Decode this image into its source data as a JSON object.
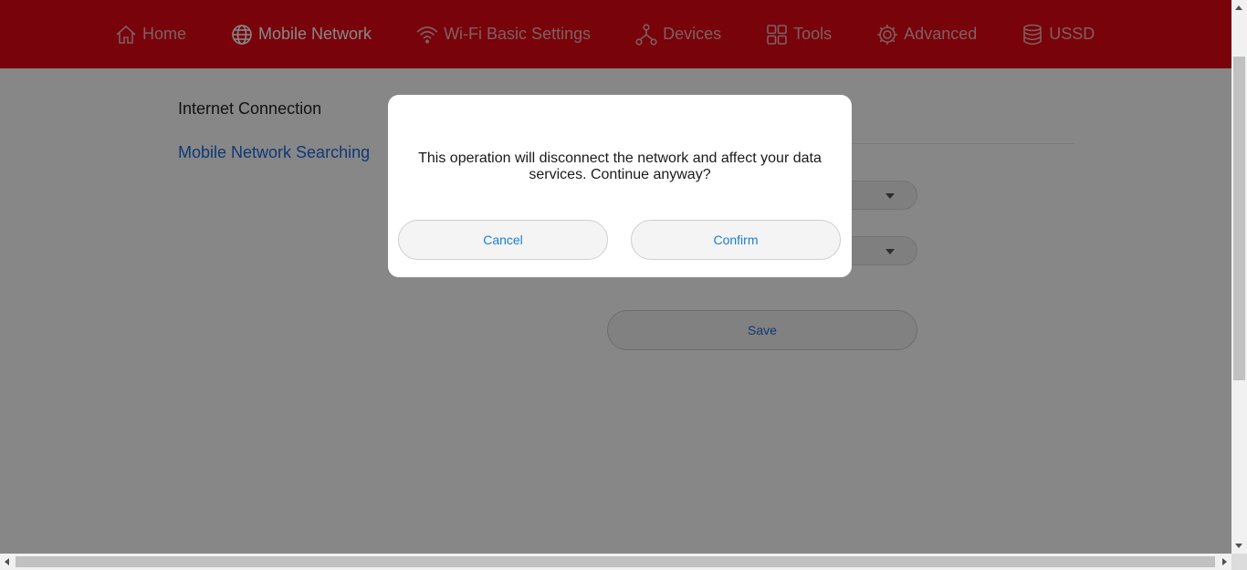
{
  "nav": {
    "items": [
      {
        "label": "Home",
        "icon": "home-icon"
      },
      {
        "label": "Mobile Network",
        "icon": "globe-icon",
        "active": true
      },
      {
        "label": "Wi-Fi Basic Settings",
        "icon": "wifi-icon"
      },
      {
        "label": "Devices",
        "icon": "devices-icon"
      },
      {
        "label": "Tools",
        "icon": "tools-icon"
      },
      {
        "label": "Advanced",
        "icon": "gear-icon"
      },
      {
        "label": "USSD",
        "icon": "database-icon"
      }
    ]
  },
  "sidebar": {
    "title": "Internet Connection",
    "link": "Mobile Network Searching"
  },
  "form": {
    "save_label": "Save"
  },
  "dialog": {
    "message": "This operation will disconnect the network and affect your data services. Continue anyway?",
    "cancel_label": "Cancel",
    "confirm_label": "Confirm"
  },
  "colors": {
    "brand_red": "#e30613",
    "link_blue": "#1d6be0"
  }
}
